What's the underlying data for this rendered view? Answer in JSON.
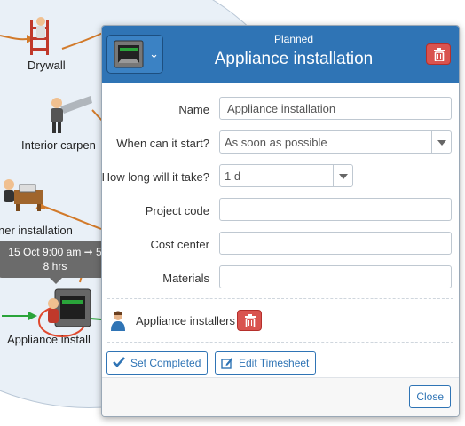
{
  "colors": {
    "accent": "#2f74b5",
    "danger": "#d9534f",
    "diagram_bg": "#e9f0f7",
    "arrow": "#d27a2a"
  },
  "diagram": {
    "nodes": [
      {
        "label": "Drywall",
        "icon": "ladder-worker-icon"
      },
      {
        "label": "Interior carpen",
        "icon": "saw-worker-icon"
      },
      {
        "label": "ner installation",
        "icon": "desk-worker-icon"
      },
      {
        "label": "Appliance install",
        "icon": "appliance-icon"
      }
    ],
    "tooltip": {
      "line1": "15 Oct 9:00 am ➞ 5",
      "line2": "8 hrs"
    }
  },
  "dialog": {
    "status": "Planned",
    "title": "Appliance installation",
    "type_icon": "appliance-icon",
    "fields": {
      "name": {
        "label": "Name",
        "value": "Appliance installation"
      },
      "start": {
        "label": "When can it start?",
        "value": "As soon as possible"
      },
      "duration": {
        "label": "How long will it take?",
        "value": "1 d"
      },
      "project_code": {
        "label": "Project code",
        "value": ""
      },
      "cost_center": {
        "label": "Cost center",
        "value": ""
      },
      "materials": {
        "label": "Materials",
        "value": ""
      }
    },
    "resource": {
      "name": "Appliance installers",
      "icon": "person-icon"
    },
    "actions": {
      "set_completed": "Set Completed",
      "edit_timesheet": "Edit Timesheet"
    },
    "close": "Close"
  }
}
